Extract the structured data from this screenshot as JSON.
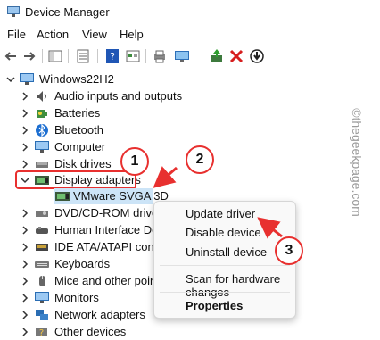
{
  "window": {
    "title": "Device Manager"
  },
  "menubar": [
    "File",
    "Action",
    "View",
    "Help"
  ],
  "tree": {
    "root": "Windows22H2",
    "items": [
      {
        "label": "Audio inputs and outputs",
        "icon": "speaker-icon"
      },
      {
        "label": "Batteries",
        "icon": "battery-icon"
      },
      {
        "label": "Bluetooth",
        "icon": "bluetooth-icon"
      },
      {
        "label": "Computer",
        "icon": "computer-icon"
      },
      {
        "label": "Disk drives",
        "icon": "disk-drive-icon"
      },
      {
        "label": "Display adapters",
        "icon": "display-adapter-icon",
        "expanded": true
      },
      {
        "label": "VMware SVGA 3D",
        "icon": "display-adapter-icon",
        "child": true
      },
      {
        "label": "DVD/CD-ROM drives",
        "icon": "dvd-icon"
      },
      {
        "label": "Human Interface Dev",
        "icon": "hid-icon"
      },
      {
        "label": "IDE ATA/ATAPI contro",
        "icon": "ide-icon"
      },
      {
        "label": "Keyboards",
        "icon": "keyboard-icon"
      },
      {
        "label": "Mice and other point",
        "icon": "mouse-icon"
      },
      {
        "label": "Monitors",
        "icon": "monitor-icon"
      },
      {
        "label": "Network adapters",
        "icon": "network-icon"
      },
      {
        "label": "Other devices",
        "icon": "other-devices-icon"
      }
    ]
  },
  "context_menu": {
    "update_driver": "Update driver",
    "disable_device": "Disable device",
    "uninstall_device": "Uninstall device",
    "scan": "Scan for hardware changes",
    "properties": "Properties"
  },
  "annotations": {
    "step1": "1",
    "step2": "2",
    "step3": "3"
  },
  "watermark": "©thegeekpage.com",
  "colors": {
    "annotation": "#e8302f",
    "selection": "#cce4f7"
  }
}
